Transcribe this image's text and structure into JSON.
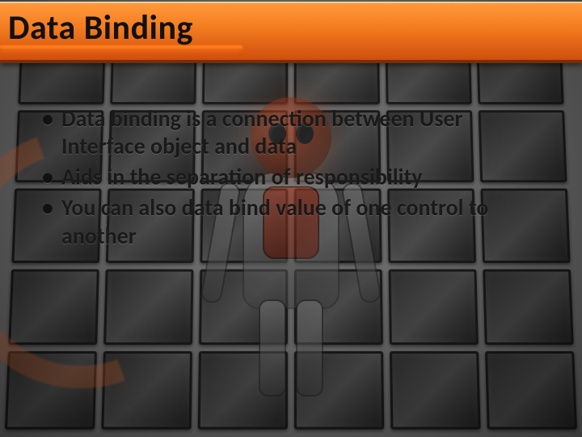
{
  "slide": {
    "title": "Data Binding",
    "bullets": [
      "Data binding is a connection between User Interface object and data",
      "Aids in the separation of responsibility",
      "You can also data bind value of one control to another"
    ]
  },
  "theme": {
    "accent": "#e56b17",
    "title_bg_top": "#ff9a3c",
    "title_bg_bottom": "#cf4e0e"
  }
}
